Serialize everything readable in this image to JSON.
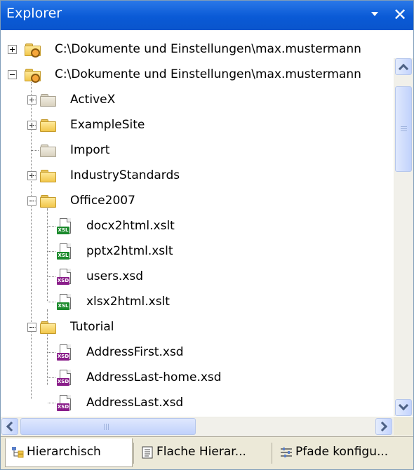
{
  "panel": {
    "title": "Explorer",
    "pin_glyph": "▼",
    "close_glyph": "✕"
  },
  "tree": {
    "roots": [
      {
        "label": "C:\\Dokumente und Einstellungen\\max.mustermann",
        "expanded": false,
        "icon": "folder-gear-icon"
      },
      {
        "label": "C:\\Dokumente und Einstellungen\\max.mustermann",
        "expanded": true,
        "icon": "folder-gear-icon"
      }
    ],
    "folders": [
      {
        "label": "ActiveX",
        "expanded": false,
        "icon": "folder-grey-icon"
      },
      {
        "label": "ExampleSite",
        "expanded": false,
        "icon": "folder-icon"
      },
      {
        "label": "Import",
        "expanded": null,
        "icon": "folder-grey-icon"
      },
      {
        "label": "IndustryStandards",
        "expanded": false,
        "icon": "folder-icon"
      },
      {
        "label": "Office2007",
        "expanded": true,
        "icon": "folder-icon"
      }
    ],
    "office_files": [
      {
        "label": "docx2html.xslt",
        "type": "xsl",
        "badge": "XSL"
      },
      {
        "label": "pptx2html.xslt",
        "type": "xsl",
        "badge": "XSL"
      },
      {
        "label": "users.xsd",
        "type": "xsd",
        "badge": "XSD"
      },
      {
        "label": "xlsx2html.xslt",
        "type": "xsl",
        "badge": "XSL"
      }
    ],
    "tutorial": {
      "label": "Tutorial",
      "expanded": true,
      "icon": "folder-icon"
    },
    "tutorial_files": [
      {
        "label": "AddressFirst.xsd",
        "type": "xsd",
        "badge": "XSD"
      },
      {
        "label": "AddressLast-home.xsd",
        "type": "xsd",
        "badge": "XSD"
      },
      {
        "label": "AddressLast.xsd",
        "type": "xsd",
        "badge": "XSD"
      }
    ]
  },
  "tabs": [
    {
      "label": "Hierarchisch",
      "icon": "hierarchy-icon",
      "active": true
    },
    {
      "label": "Flache Hierar...",
      "icon": "document-icon",
      "active": false
    },
    {
      "label": "Pfade konfigu...",
      "icon": "configure-paths-icon",
      "active": false
    }
  ],
  "colors": {
    "titlebar": "#0a5ad6",
    "xsl_badge": "#1b8a2c",
    "xsd_badge": "#8a1e8a",
    "folder": "#f2c64a"
  }
}
